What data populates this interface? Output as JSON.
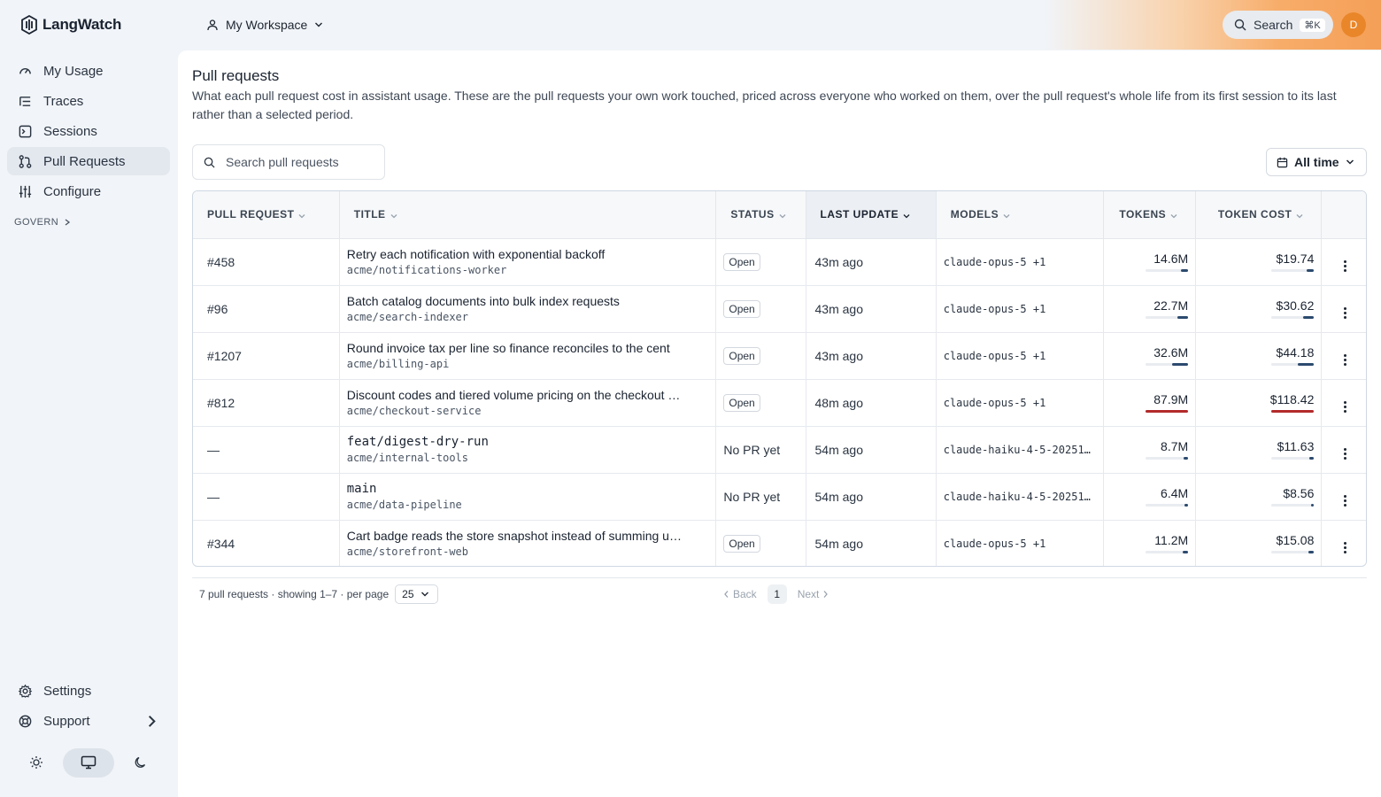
{
  "app": {
    "name": "LangWatch"
  },
  "sidebar": {
    "items": [
      {
        "label": "My Usage",
        "icon": "gauge-icon",
        "active": false
      },
      {
        "label": "Traces",
        "icon": "list-icon",
        "active": false
      },
      {
        "label": "Sessions",
        "icon": "terminal-icon",
        "active": false
      },
      {
        "label": "Pull Requests",
        "icon": "git-pull-request-icon",
        "active": true
      },
      {
        "label": "Configure",
        "icon": "sliders-icon",
        "active": false
      }
    ],
    "govern_label": "GOVERN",
    "bottom": [
      {
        "label": "Settings",
        "icon": "gear-icon"
      },
      {
        "label": "Support",
        "icon": "lifebuoy-icon"
      }
    ]
  },
  "header": {
    "workspace": "My Workspace",
    "search_label": "Search",
    "search_shortcut": "⌘K",
    "avatar_initial": "D"
  },
  "page": {
    "title": "Pull requests",
    "description": "What each pull request cost in assistant usage. These are the pull requests your own work touched, priced across everyone who worked on them, over the pull request's whole life from its first session to its last rather than a selected period.",
    "search_placeholder": "Search pull requests",
    "range_label": "All time"
  },
  "table": {
    "columns": [
      "PULL REQUEST",
      "TITLE",
      "STATUS",
      "LAST UPDATE",
      "MODELS",
      "TOKENS",
      "TOKEN COST"
    ],
    "sorted_column": "LAST UPDATE",
    "rows": [
      {
        "pr": "#458",
        "title": "Retry each notification with exponential backoff",
        "title_mono": false,
        "repo": "acme/notifications-worker",
        "status": "Open",
        "status_badge": true,
        "updated": "43m ago",
        "models": "claude-opus-5 +1",
        "tokens": "14.6M",
        "tokens_share": 0.166,
        "cost": "$19.74",
        "cost_share": 0.167,
        "highlight": false
      },
      {
        "pr": "#96",
        "title": "Batch catalog documents into bulk index requests",
        "title_mono": false,
        "repo": "acme/search-indexer",
        "status": "Open",
        "status_badge": true,
        "updated": "43m ago",
        "models": "claude-opus-5 +1",
        "tokens": "22.7M",
        "tokens_share": 0.258,
        "cost": "$30.62",
        "cost_share": 0.259,
        "highlight": false
      },
      {
        "pr": "#1207",
        "title": "Round invoice tax per line so finance reconciles to the cent",
        "title_mono": false,
        "repo": "acme/billing-api",
        "status": "Open",
        "status_badge": true,
        "updated": "43m ago",
        "models": "claude-opus-5 +1",
        "tokens": "32.6M",
        "tokens_share": 0.371,
        "cost": "$44.18",
        "cost_share": 0.373,
        "highlight": false
      },
      {
        "pr": "#812",
        "title": "Discount codes and tiered volume pricing on the checkout …",
        "title_mono": false,
        "repo": "acme/checkout-service",
        "status": "Open",
        "status_badge": true,
        "updated": "48m ago",
        "models": "claude-opus-5 +1",
        "tokens": "87.9M",
        "tokens_share": 1.0,
        "cost": "$118.42",
        "cost_share": 1.0,
        "highlight": true
      },
      {
        "pr": "—",
        "title": "feat/digest-dry-run",
        "title_mono": true,
        "repo": "acme/internal-tools",
        "status": "No PR yet",
        "status_badge": false,
        "updated": "54m ago",
        "models": "claude-haiku-4-5-20251…",
        "tokens": "8.7M",
        "tokens_share": 0.099,
        "cost": "$11.63",
        "cost_share": 0.098,
        "highlight": false
      },
      {
        "pr": "—",
        "title": "main",
        "title_mono": true,
        "repo": "acme/data-pipeline",
        "status": "No PR yet",
        "status_badge": false,
        "updated": "54m ago",
        "models": "claude-haiku-4-5-20251…",
        "tokens": "6.4M",
        "tokens_share": 0.073,
        "cost": "$8.56",
        "cost_share": 0.072,
        "highlight": false
      },
      {
        "pr": "#344",
        "title": "Cart badge reads the store snapshot instead of summing u…",
        "title_mono": false,
        "repo": "acme/storefront-web",
        "status": "Open",
        "status_badge": true,
        "updated": "54m ago",
        "models": "claude-opus-5 +1",
        "tokens": "11.2M",
        "tokens_share": 0.127,
        "cost": "$15.08",
        "cost_share": 0.127,
        "highlight": false
      }
    ]
  },
  "footer": {
    "summary": "7 pull requests · showing 1–7 · per page",
    "per_page": "25",
    "back_label": "Back",
    "page": "1",
    "next_label": "Next"
  },
  "colors": {
    "accent_bar": "#2c4a6e",
    "highlight_bar": "#b32a2a",
    "avatar": "#e9862a"
  }
}
